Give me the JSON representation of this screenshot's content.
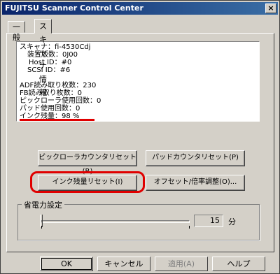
{
  "window": {
    "title": "FUJITSU Scanner Control Center",
    "close": "×"
  },
  "tabs": [
    "一般",
    "スキャナ情報"
  ],
  "info": {
    "scanner": "スキャナ：fi-4530Cdj",
    "firmware": "装置版数：0J00",
    "host_id": "Host ID：#0",
    "scsi_id": "SCSI ID：#6",
    "adf_count": "ADF読み取り枚数：230",
    "fb_count": "FB読み取り枚数：0",
    "pickroller_count": "ピックローラ使用回数：0",
    "pad_count": "パッド使用回数：0",
    "ink_level": "インク残量：98 %"
  },
  "buttons": {
    "pickroller_reset": "ピックローラカウンタリセット(R)",
    "pad_reset": "パッドカウンタリセット(P)",
    "ink_reset": "インク残量リセット(I)",
    "offset_adjust": "オフセット/倍率調整(O)..."
  },
  "power": {
    "label": "省電力設定",
    "value": "15",
    "unit": "分"
  },
  "footer": {
    "ok": "OK",
    "cancel": "キャンセル",
    "apply": "適用(A)",
    "help": "ヘルプ"
  }
}
